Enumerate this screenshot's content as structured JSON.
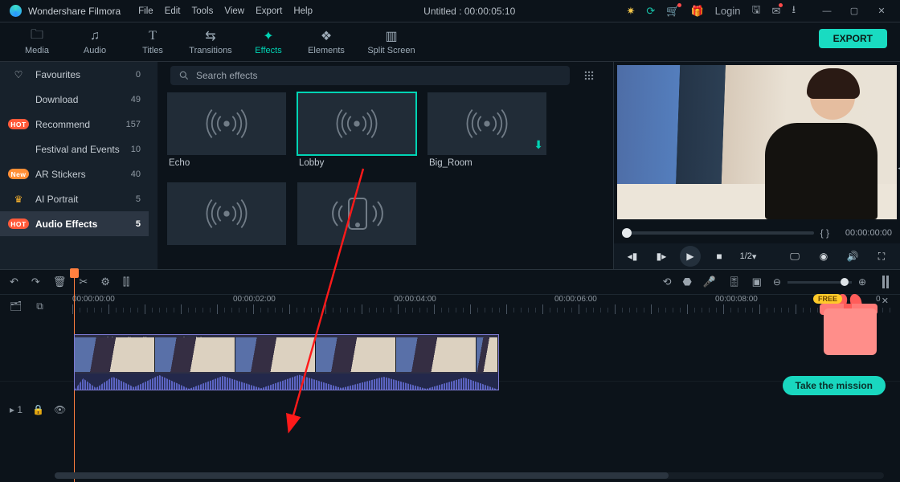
{
  "title": {
    "app": "Wondershare Filmora",
    "doc": "Untitled : 00:00:05:10"
  },
  "menu": [
    "File",
    "Edit",
    "Tools",
    "View",
    "Export",
    "Help"
  ],
  "titlebar_icons": {
    "login": "Login"
  },
  "ribbon": [
    {
      "icon": "folder",
      "label": "Media"
    },
    {
      "icon": "note",
      "label": "Audio"
    },
    {
      "icon": "T",
      "label": "Titles"
    },
    {
      "icon": "swap",
      "label": "Transitions"
    },
    {
      "icon": "sparkle",
      "label": "Effects",
      "active": true
    },
    {
      "icon": "stack",
      "label": "Elements"
    },
    {
      "icon": "split",
      "label": "Split Screen"
    }
  ],
  "export_btn": "EXPORT",
  "sidebar": [
    {
      "tag": null,
      "icon": "heart",
      "name": "Favourites",
      "count": 0
    },
    {
      "tag": null,
      "icon": null,
      "name": "Download",
      "count": 49
    },
    {
      "tag": "HOT",
      "icon": null,
      "name": "Recommend",
      "count": 157
    },
    {
      "tag": null,
      "icon": null,
      "name": "Festival and Events",
      "count": 10
    },
    {
      "tag": "New",
      "icon": null,
      "name": "AR Stickers",
      "count": 40
    },
    {
      "tag": null,
      "icon": "crown",
      "name": "AI Portrait",
      "count": 5
    },
    {
      "tag": "HOT",
      "icon": null,
      "name": "Audio Effects",
      "count": 5,
      "selected": true
    }
  ],
  "search": {
    "placeholder": "Search effects"
  },
  "effects": [
    {
      "name": "Echo",
      "kind": "sound"
    },
    {
      "name": "Lobby",
      "kind": "sound",
      "selected": true
    },
    {
      "name": "Big_Room",
      "kind": "sound",
      "download": true
    },
    {
      "name": "",
      "kind": "sound"
    },
    {
      "name": "",
      "kind": "phone"
    }
  ],
  "preview": {
    "time": "00:00:00:00",
    "marks": "{       }",
    "ratio": "1/2"
  },
  "ruler": [
    "00:00:00:00",
    "00:00:02:00",
    "00:00:04:00",
    "00:00:06:00",
    "00:00:08:00",
    "0"
  ],
  "track_label": "1",
  "clip": {
    "name": "Add Audio effects sample video"
  },
  "mission": "Take the mission",
  "gift_free": "FREE"
}
